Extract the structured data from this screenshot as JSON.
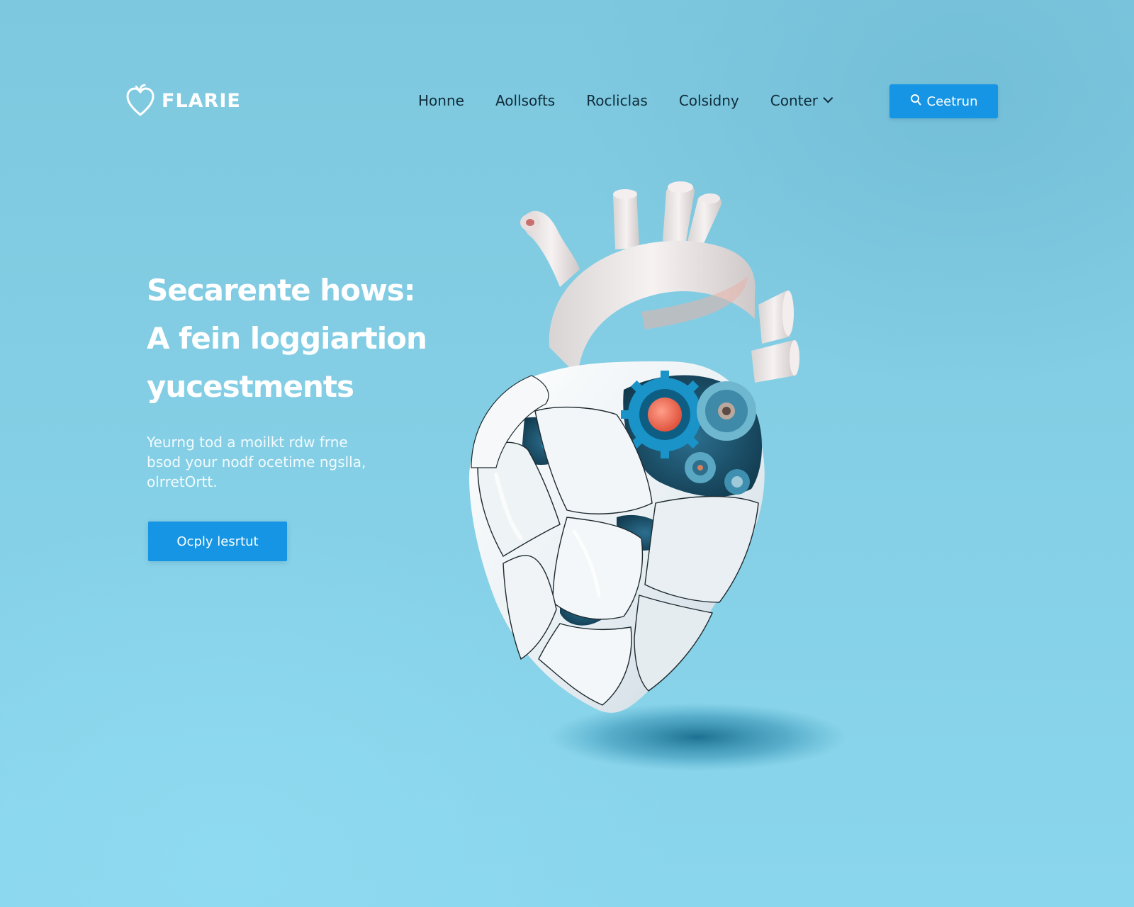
{
  "brand": {
    "name": "FLARIE",
    "logo_icon": "heart-icon"
  },
  "nav": {
    "items": [
      {
        "label": "Honne"
      },
      {
        "label": "Aollsofts"
      },
      {
        "label": "Rocliclas"
      },
      {
        "label": "Colsidny"
      },
      {
        "label": "Conter"
      }
    ],
    "cta": {
      "label": "Ceetrun",
      "icon": "search-icon"
    }
  },
  "hero": {
    "title_lines": [
      "Secarente hows:",
      "A fein loggiartion",
      "yucestments"
    ],
    "subtitle_lines": [
      "Yeurng tod a moilkt rdw frne",
      "bsod your nodf ocetime ngslla,",
      "olrretOrtt."
    ],
    "cta_label": "Ocply lesrtut",
    "image": "robotic-heart-illustration"
  },
  "colors": {
    "accent": "#1595e3",
    "background": "#84cfe5",
    "heading": "#ffffff",
    "nav_text": "#0f2c3a"
  }
}
